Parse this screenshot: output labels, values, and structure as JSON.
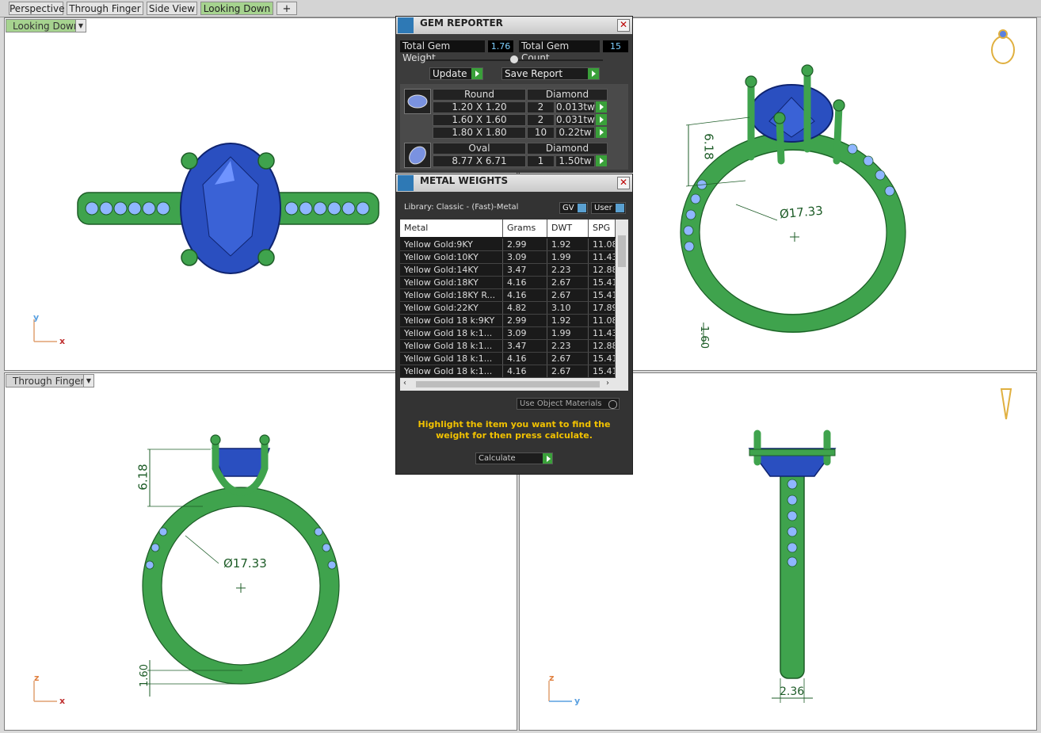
{
  "tabs": [
    "Perspective",
    "Through Finger",
    "Side View",
    "Looking Down"
  ],
  "active_tab": "Looking Down",
  "viewports": {
    "top_left": {
      "label": "Looking Down",
      "axis_y": "y",
      "axis_x": "x"
    },
    "top_right": {
      "dim_height": "6.18",
      "dim_diameter": "Ø17.33",
      "dim_thickness": "1.60"
    },
    "bottom_left": {
      "label": "Through Finger",
      "dim_height": "6.18",
      "dim_diameter": "Ø17.33",
      "dim_thickness": "1.60",
      "axis_z": "z",
      "axis_x": "x"
    },
    "bottom_right": {
      "dim_width": "2.36",
      "axis_z": "z",
      "axis_y": "y"
    }
  },
  "gem_reporter": {
    "title": "GEM REPORTER",
    "total_weight_label": "Total Gem Weight",
    "total_weight": "1.76",
    "total_count_label": "Total Gem Count",
    "total_count": "15",
    "update_label": "Update",
    "save_label": "Save Report",
    "groups": [
      {
        "shape": "Round",
        "type": "Diamond",
        "rows": [
          {
            "size": "1.20 X 1.20",
            "count": "2",
            "weight": "0.013tw"
          },
          {
            "size": "1.60 X 1.60",
            "count": "2",
            "weight": "0.031tw"
          },
          {
            "size": "1.80 X 1.80",
            "count": "10",
            "weight": "0.22tw"
          }
        ]
      },
      {
        "shape": "Oval",
        "type": "Diamond",
        "rows": [
          {
            "size": "8.77 X 6.71",
            "count": "1",
            "weight": "1.50tw"
          }
        ]
      }
    ]
  },
  "metal_weights": {
    "title": "METAL WEIGHTS",
    "library": "Library: Classic - (Fast)-Metal",
    "gv_label": "GV",
    "user_label": "User",
    "columns": [
      "Metal",
      "Grams",
      "DWT",
      "SPG"
    ],
    "rows": [
      [
        "Yellow Gold:9KY",
        "2.99",
        "1.92",
        "11.08"
      ],
      [
        "Yellow Gold:10KY",
        "3.09",
        "1.99",
        "11.43"
      ],
      [
        "Yellow Gold:14KY",
        "3.47",
        "2.23",
        "12.88"
      ],
      [
        "Yellow Gold:18KY",
        "4.16",
        "2.67",
        "15.41"
      ],
      [
        "Yellow Gold:18KY R...",
        "4.16",
        "2.67",
        "15.41"
      ],
      [
        "Yellow Gold:22KY",
        "4.82",
        "3.10",
        "17.89"
      ],
      [
        "Yellow Gold 18 k:9KY",
        "2.99",
        "1.92",
        "11.08"
      ],
      [
        "Yellow Gold 18 k:1...",
        "3.09",
        "1.99",
        "11.43"
      ],
      [
        "Yellow Gold 18 k:1...",
        "3.47",
        "2.23",
        "12.88"
      ],
      [
        "Yellow Gold 18 k:1...",
        "4.16",
        "2.67",
        "15.41"
      ],
      [
        "Yellow Gold 18 k:1...",
        "4.16",
        "2.67",
        "15.41"
      ]
    ],
    "use_object_materials": "Use Object Materials",
    "hint": "Highlight the item you want to find the weight for then press calculate.",
    "calculate_label": "Calculate"
  },
  "colors": {
    "metal": "#3fa34d",
    "gem": "#2a4fc0",
    "pave": "#8fb6ff",
    "active_tab": "#a6d38f",
    "hint_text": "#f2c200"
  }
}
